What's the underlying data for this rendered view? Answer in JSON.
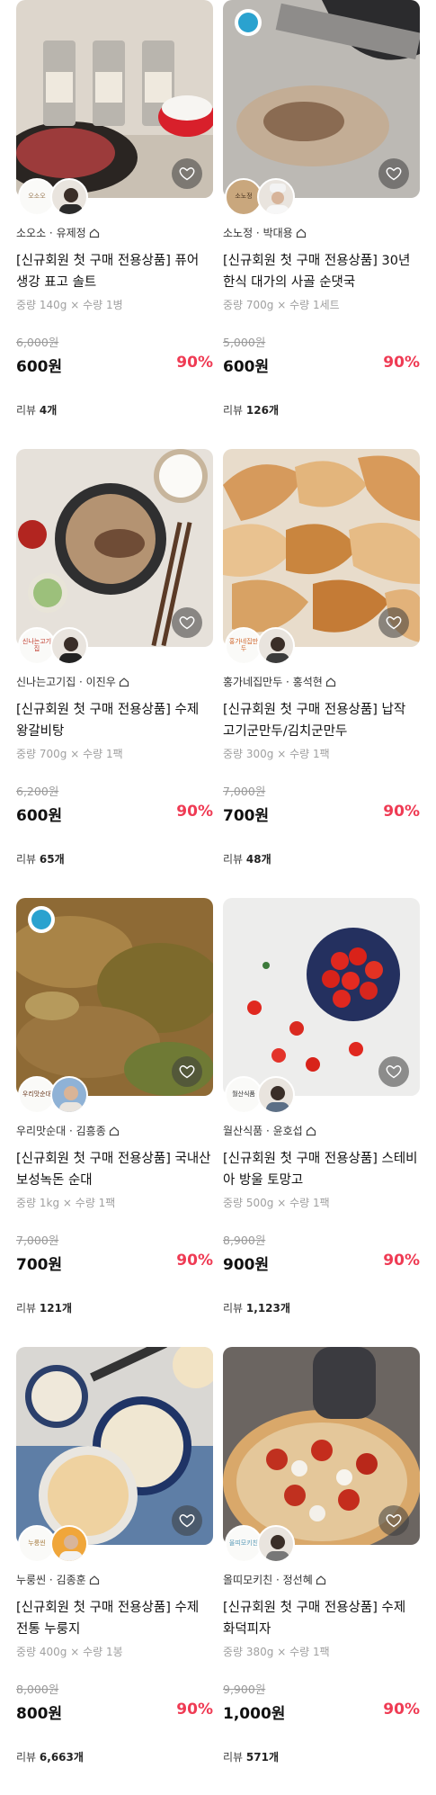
{
  "icons": {
    "like": "heart-outline-icon",
    "store": "house-icon"
  },
  "colors": {
    "discount": "#ef3b54",
    "text": "#111111",
    "muted": "#a0a0a0"
  },
  "products": [
    {
      "brand_badge": "오소오",
      "seller": "소오소 · 유제정",
      "title": "[신규회원 첫 구매 전용상품] 퓨어 생강 표고 솔트",
      "spec": "중량 140g × 수량 1병",
      "original_price": "6,000원",
      "price": "600원",
      "discount": "90%",
      "review_label": "리뷰",
      "review_count": "4개"
    },
    {
      "brand_badge": "소노정",
      "seller": "소노정 · 박대용",
      "title": "[신규회원 첫 구매 전용상품] 30년 한식 대가의 사골 순댓국",
      "spec": "중량 700g × 수량 1세트",
      "original_price": "5,000원",
      "price": "600원",
      "discount": "90%",
      "review_label": "리뷰",
      "review_count": "126개"
    },
    {
      "brand_badge": "신나는고기집",
      "seller": "신나는고기집 · 이진우",
      "title": "[신규회원 첫 구매 전용상품] 수제 왕갈비탕",
      "spec": "중량 700g × 수량 1팩",
      "original_price": "6,200원",
      "price": "600원",
      "discount": "90%",
      "review_label": "리뷰",
      "review_count": "65개"
    },
    {
      "brand_badge": "홍가네집만두",
      "seller": "홍가네집만두 · 홍석현",
      "title": "[신규회원 첫 구매 전용상품] 납작 고기군만두/김치군만두",
      "spec": "중량 300g × 수량 1팩",
      "original_price": "7,000원",
      "price": "700원",
      "discount": "90%",
      "review_label": "리뷰",
      "review_count": "48개"
    },
    {
      "brand_badge": "우리맛순대",
      "seller": "우리맛순대 · 김흥종",
      "title": "[신규회원 첫 구매 전용상품] 국내산 보성녹돈 순대",
      "spec": "중량 1kg × 수량 1팩",
      "original_price": "7,000원",
      "price": "700원",
      "discount": "90%",
      "review_label": "리뷰",
      "review_count": "121개"
    },
    {
      "brand_badge": "월산식품",
      "seller": "월산식품 · 윤호섭",
      "title": "[신규회원 첫 구매 전용상품] 스테비아 방울 토망고",
      "spec": "중량 500g × 수량 1팩",
      "original_price": "8,900원",
      "price": "900원",
      "discount": "90%",
      "review_label": "리뷰",
      "review_count": "1,123개"
    },
    {
      "brand_badge": "누룽씬",
      "seller": "누룽씬 · 김종훈",
      "title": "[신규회원 첫 구매 전용상품] 수제 전통 누룽지",
      "spec": "중량 400g × 수량 1봉",
      "original_price": "8,000원",
      "price": "800원",
      "discount": "90%",
      "review_label": "리뷰",
      "review_count": "6,663개"
    },
    {
      "brand_badge": "올띠모키친",
      "seller": "올띠모키친 · 정선혜",
      "title": "[신규회원 첫 구매 전용상품] 수제 화덕피자",
      "spec": "중량 380g × 수량 1팩",
      "original_price": "9,900원",
      "price": "1,000원",
      "discount": "90%",
      "review_label": "리뷰",
      "review_count": "571개"
    }
  ]
}
